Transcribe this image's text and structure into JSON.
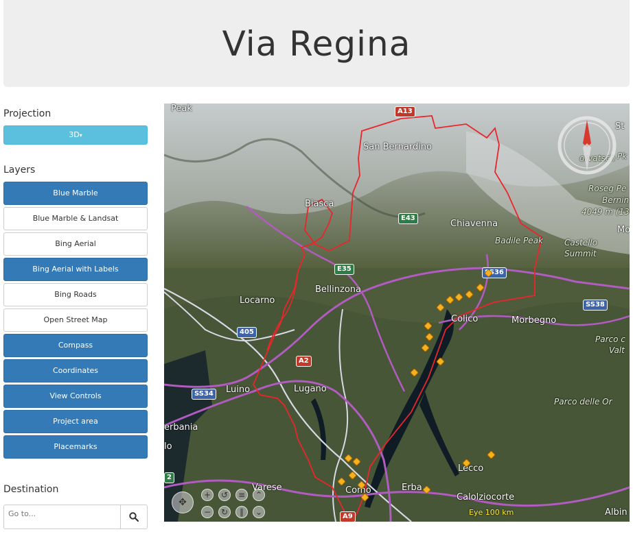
{
  "page": {
    "title": "Via Regina"
  },
  "projection": {
    "label": "Projection",
    "button_label": "3D",
    "caret": "▾"
  },
  "layers": {
    "label": "Layers",
    "items": [
      {
        "label": "Blue Marble",
        "active": true
      },
      {
        "label": "Blue Marble & Landsat",
        "active": false
      },
      {
        "label": "Bing Aerial",
        "active": false
      },
      {
        "label": "Bing Aerial with Labels",
        "active": true
      },
      {
        "label": "Bing Roads",
        "active": false
      },
      {
        "label": "Open Street Map",
        "active": false
      },
      {
        "label": "Compass",
        "active": true
      },
      {
        "label": "Coordinates",
        "active": true
      },
      {
        "label": "View Controls",
        "active": true
      },
      {
        "label": "Project area",
        "active": true
      },
      {
        "label": "Placemarks",
        "active": true
      }
    ]
  },
  "destination": {
    "label": "Destination",
    "placeholder": "Go to...",
    "search_icon": "search-icon"
  },
  "map": {
    "place_labels": {
      "peak": "Peak",
      "san_bernardino": "San Bernardino",
      "biasca": "Biasca",
      "chiavenna": "Chiavenna",
      "badile_peak": "Badile Peak",
      "castello_summit_1": "Castello",
      "castello_summit_2": "Summit",
      "locarno": "Locarno",
      "bellinzona": "Bellinzona",
      "colico": "Colico",
      "morbegno": "Morbegno",
      "parco_1": "Parco c",
      "parco_2": "Valt",
      "luino": "Luino",
      "lugano": "Lugano",
      "parco_delle": "Parco delle Or",
      "erbania": "erbania",
      "varese": "Varese",
      "como": "Como",
      "erba": "Erba",
      "lecco": "Lecco",
      "calolziocorte": "Calolziocorte",
      "corvatsch": "orvatsch",
      "roseg": "Roseg Pe",
      "bernina": "Bernin",
      "elev": "4049 m (13",
      "st": "St",
      "albin": "Albin",
      "mo": "Mo",
      "pk": "Pk",
      "lo": "lo"
    },
    "shields": {
      "a13": "A13",
      "e43": "E43",
      "e35": "E35",
      "ss36": "SS36",
      "ss38": "SS38",
      "a405": "405",
      "a2": "A2",
      "ss34": "SS34",
      "a9": "A9",
      "s2": "2"
    },
    "eye": {
      "label": "Eye",
      "value": "100 km"
    },
    "colors": {
      "boundary": "#e8262b",
      "roads": "#b05cc0",
      "border": "#d9d9e6",
      "lake": "#0f1c26"
    }
  }
}
